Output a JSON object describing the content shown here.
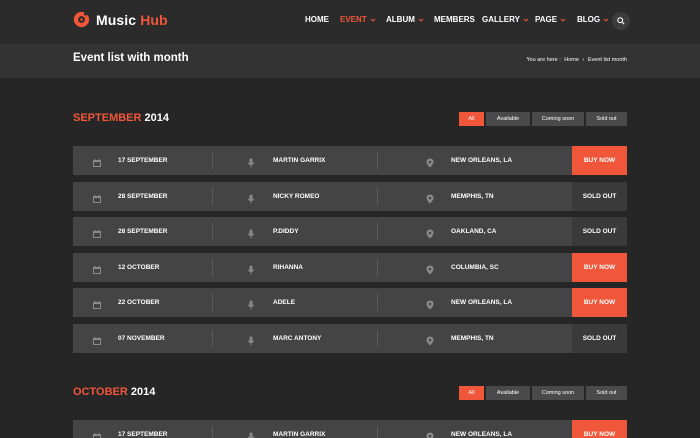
{
  "brand": {
    "word1": "Music",
    "word2": "Hub"
  },
  "nav": {
    "items": [
      {
        "label": "HOME",
        "active": false,
        "dropdown": false
      },
      {
        "label": "EVENT",
        "active": true,
        "dropdown": true
      },
      {
        "label": "ALBUM",
        "active": false,
        "dropdown": true
      },
      {
        "label": "MEMBERS",
        "active": false,
        "dropdown": false
      },
      {
        "label": "GALLERY",
        "active": false,
        "dropdown": true
      },
      {
        "label": "PAGE",
        "active": false,
        "dropdown": true
      },
      {
        "label": "BLOG",
        "active": false,
        "dropdown": true
      }
    ],
    "search_icon": "search-icon"
  },
  "page": {
    "title": "Event list with month",
    "breadcrumb": {
      "prefix": "You are here :",
      "home": "Home",
      "sep": "›",
      "current": "Event list month"
    }
  },
  "filters": [
    "All",
    "Available",
    "Coming soon",
    "Sold out"
  ],
  "sections": [
    {
      "month": "SEPTEMBER",
      "year": "2014",
      "events": [
        {
          "date": "17 SEPTEMBER",
          "artist": "MARTIN GARRIX",
          "location": "NEW ORLEANS, LA",
          "action": "BUY NOW"
        },
        {
          "date": "28 SEPTEMBER",
          "artist": "NICKY ROMEO",
          "location": "MEMPHIS, TN",
          "action": "SOLD OUT"
        },
        {
          "date": "28 SEPTEMBER",
          "artist": "P.DIDDY",
          "location": "OAKLAND, CA",
          "action": "SOLD OUT"
        },
        {
          "date": "12 OCTOBER",
          "artist": "RIHANNA",
          "location": "COLUMBIA, SC",
          "action": "BUY NOW"
        },
        {
          "date": "22 OCTOBER",
          "artist": "ADELE",
          "location": "NEW ORLEANS, LA",
          "action": "BUY NOW"
        },
        {
          "date": "07 NOVEMBER",
          "artist": "MARC ANTONY",
          "location": "MEMPHIS, TN",
          "action": "SOLD OUT"
        }
      ]
    },
    {
      "month": "OCTOBER",
      "year": "2014",
      "events": [
        {
          "date": "17 SEPTEMBER",
          "artist": "MARTIN GARRIX",
          "location": "NEW ORLEANS, LA",
          "action": "BUY NOW"
        }
      ]
    }
  ],
  "colors": {
    "accent": "#f0563a",
    "row": "#444444",
    "background": "#262626"
  },
  "icons": {
    "date": "calendar-icon",
    "artist": "microphone-icon",
    "location": "map-pin-icon"
  }
}
